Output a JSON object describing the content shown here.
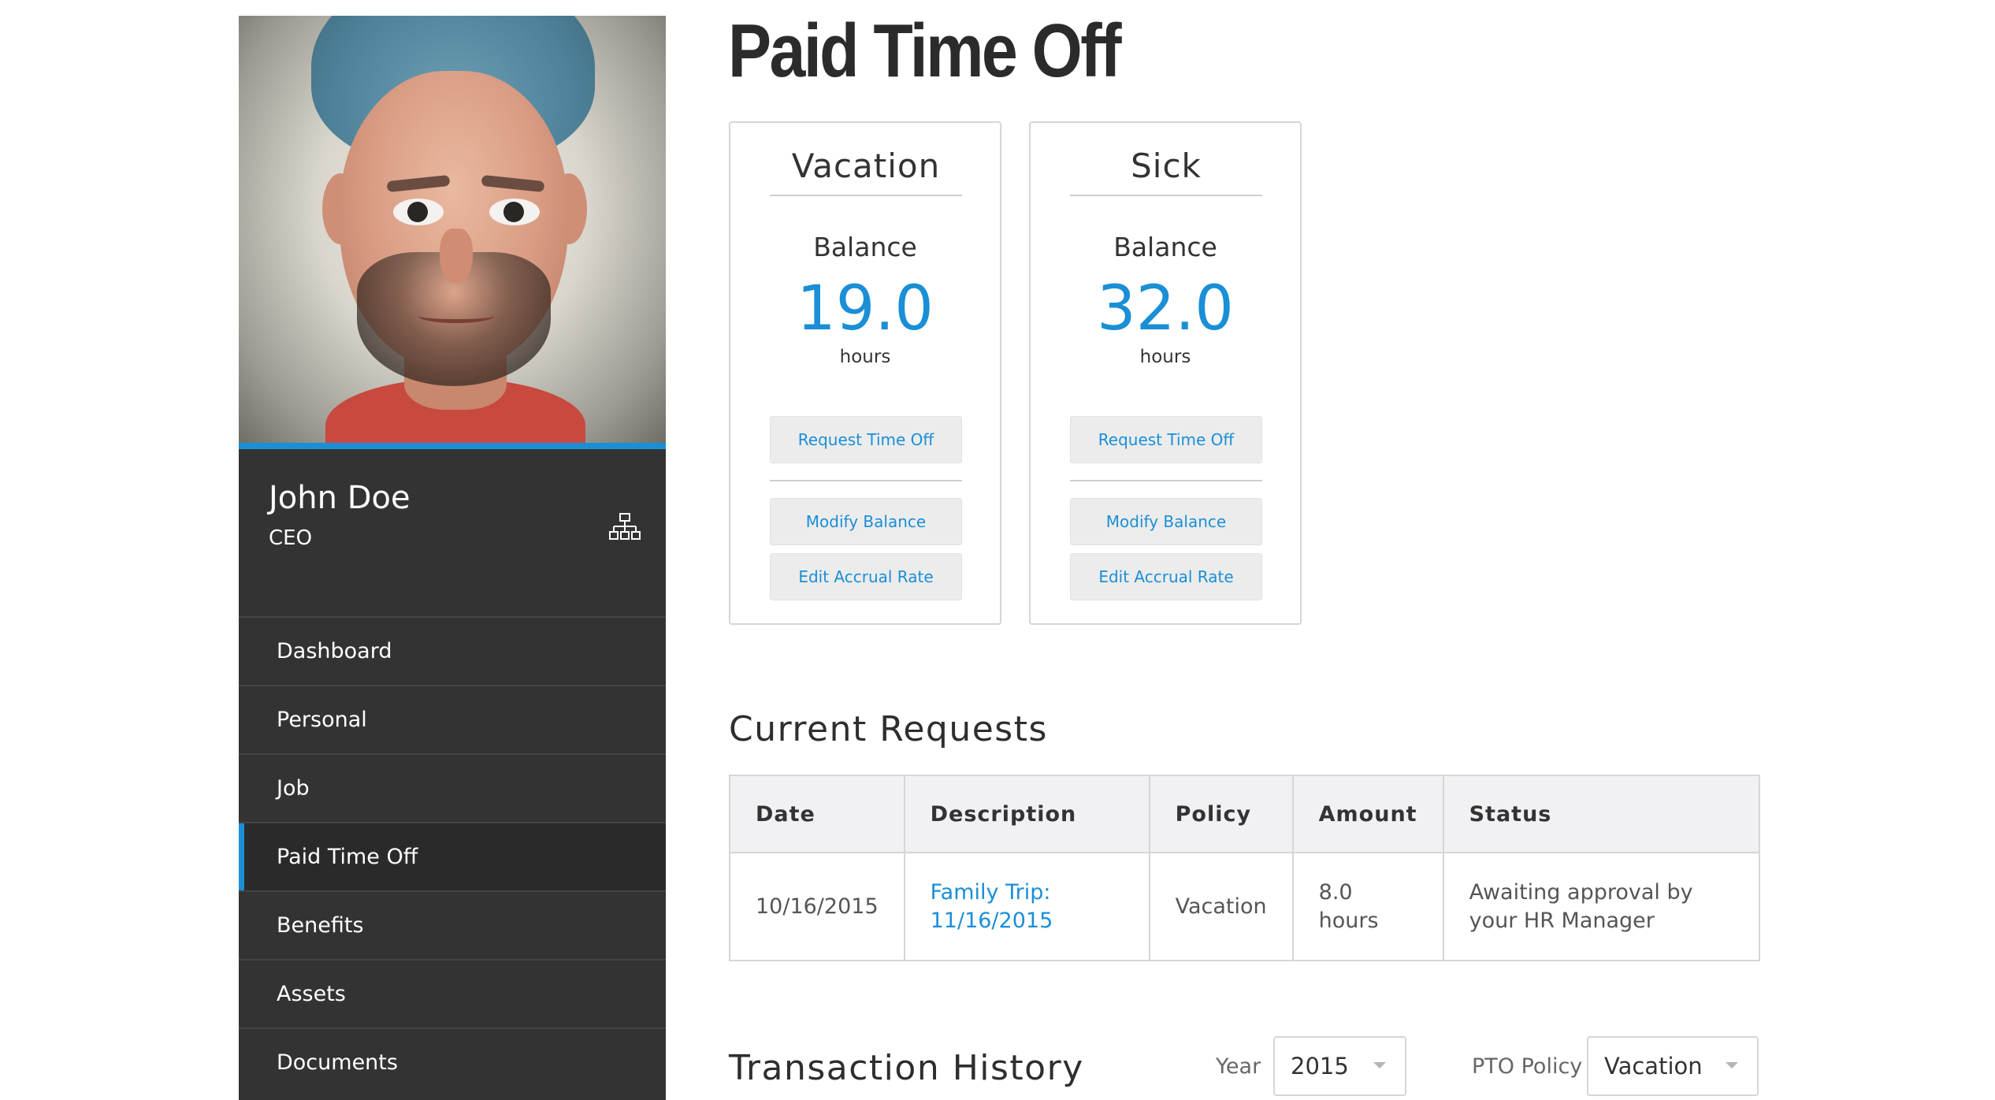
{
  "profile": {
    "name": "John Doe",
    "title": "CEO"
  },
  "nav": {
    "items": [
      {
        "label": "Dashboard"
      },
      {
        "label": "Personal"
      },
      {
        "label": "Job"
      },
      {
        "label": "Paid Time Off"
      },
      {
        "label": "Benefits"
      },
      {
        "label": "Assets"
      },
      {
        "label": "Documents"
      }
    ],
    "active_index": 3
  },
  "page": {
    "title": "Paid Time Off"
  },
  "cards": [
    {
      "heading": "Vacation",
      "balance_label": "Balance",
      "balance_value": "19.0",
      "balance_unit": "hours",
      "request_label": "Request Time Off",
      "modify_label": "Modify Balance",
      "accrual_label": "Edit Accrual Rate"
    },
    {
      "heading": "Sick",
      "balance_label": "Balance",
      "balance_value": "32.0",
      "balance_unit": "hours",
      "request_label": "Request Time Off",
      "modify_label": "Modify Balance",
      "accrual_label": "Edit Accrual Rate"
    }
  ],
  "current_requests": {
    "title": "Current Requests",
    "columns": [
      "Date",
      "Description",
      "Policy",
      "Amount",
      "Status"
    ],
    "rows": [
      {
        "date": "10/16/2015",
        "description": "Family Trip: 11/16/2015",
        "policy": "Vacation",
        "amount": "8.0 hours",
        "status": "Awaiting approval by your HR Manager"
      }
    ]
  },
  "transaction_history": {
    "title": "Transaction History",
    "year_label": "Year",
    "year_value": "2015",
    "policy_label": "PTO Policy",
    "policy_value": "Vacation"
  },
  "colors": {
    "accent": "#1a8fd6",
    "sidebar_bg": "#333333",
    "sidebar_active_bg": "#2a2a2a",
    "table_header_bg": "#f1f1f3",
    "button_bg": "#ececec"
  },
  "icons": {
    "org_chart": "org-chart-icon",
    "dropdown_caret": "chevron-down-icon"
  }
}
